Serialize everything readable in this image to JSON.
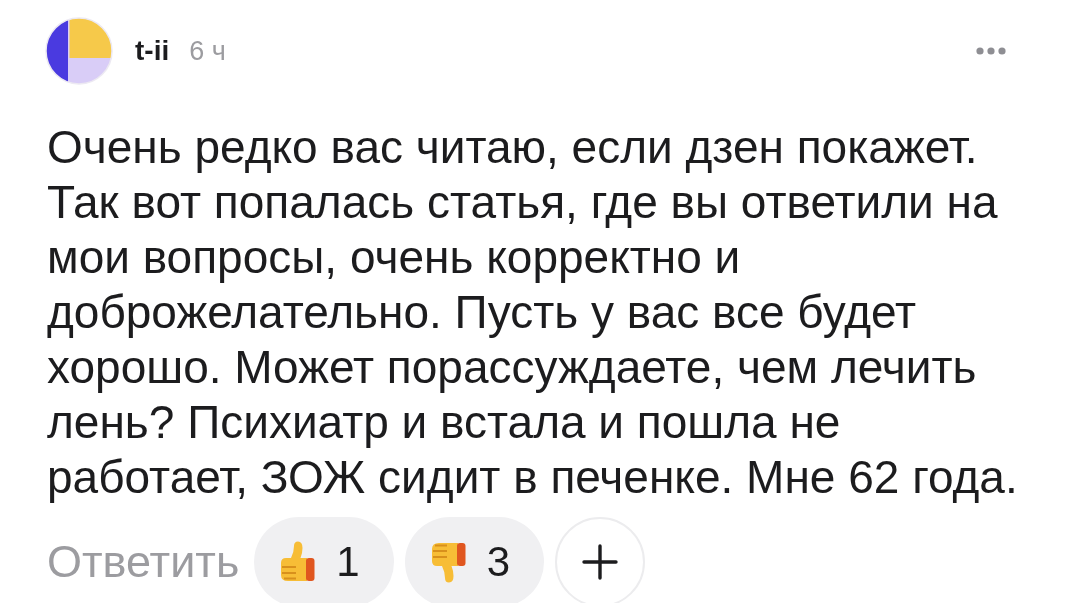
{
  "comment": {
    "author": "t-ii",
    "time": "6 ч",
    "text": "Очень редко вас читаю, если дзен покажет. Так вот попалась статья, где вы ответили на мои вопросы, очень корректно и доброжелательно. Пусть у вас все будет хорошо. Может порассуждаете, чем лечить лень? Психиатр и встала и пошла не работает, ЗОЖ сидит в печенке. Мне 62 года.",
    "reply_label": "Ответить",
    "reactions": [
      {
        "kind": "like",
        "count": "1"
      },
      {
        "kind": "dislike",
        "count": "3"
      }
    ]
  }
}
